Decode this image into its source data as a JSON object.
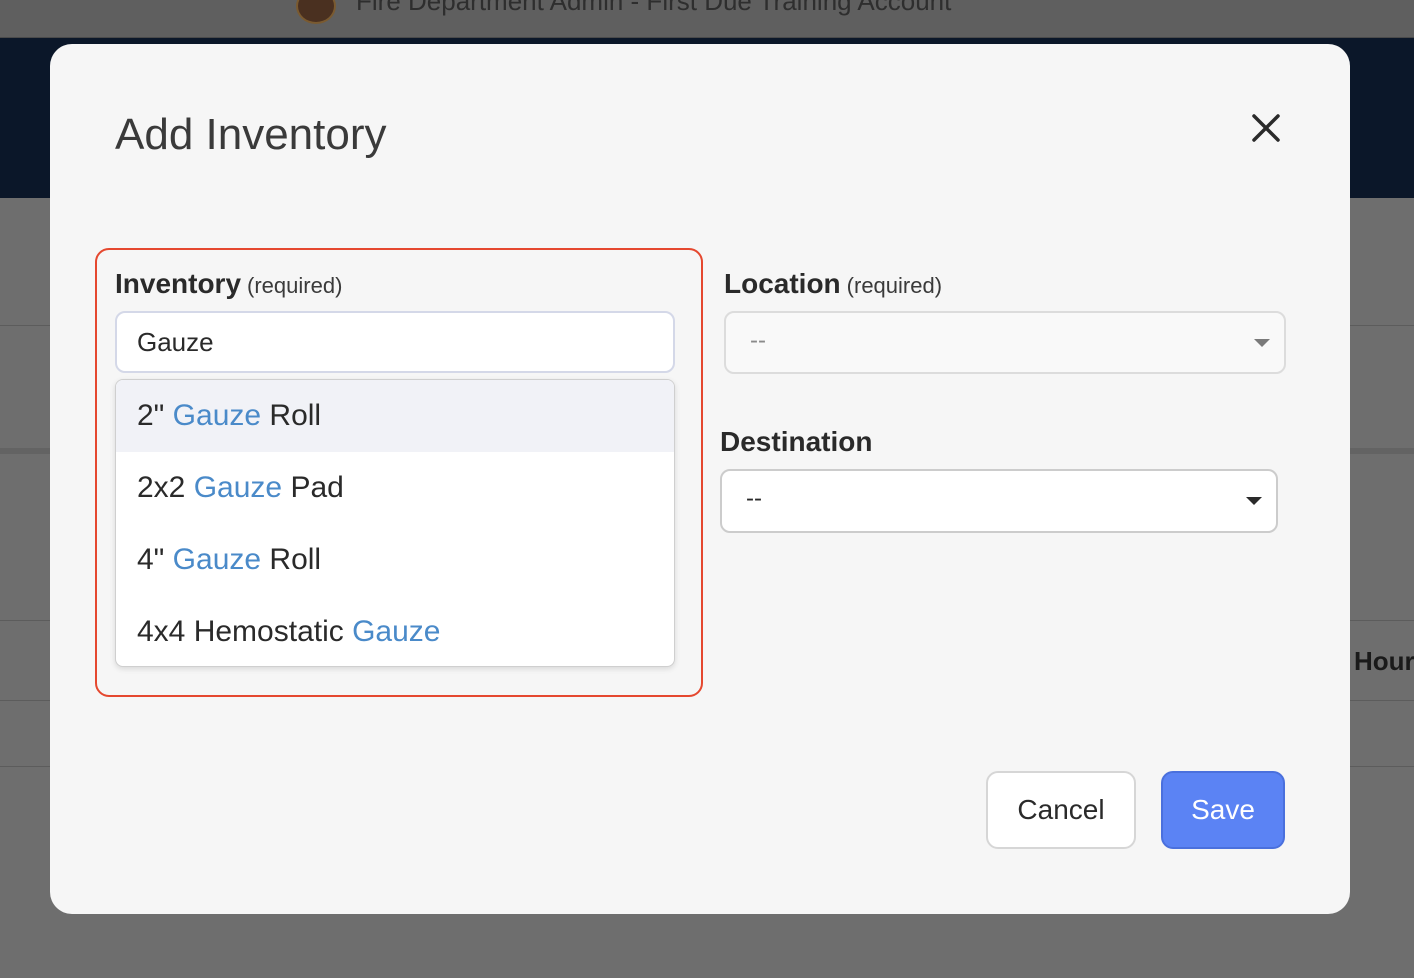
{
  "background": {
    "app_title": "Fire Department Admin - First Due Training Account",
    "partial_column_header": "Hour"
  },
  "modal": {
    "title": "Add Inventory",
    "close_icon": "close-icon"
  },
  "inventory_field": {
    "label": "Inventory",
    "required_note": "(required)",
    "value": "Gauze",
    "options": [
      {
        "prefix": "2\" ",
        "match": "Gauze",
        "suffix": " Roll"
      },
      {
        "prefix": "2x2 ",
        "match": "Gauze",
        "suffix": " Pad"
      },
      {
        "prefix": "4\" ",
        "match": "Gauze",
        "suffix": " Roll"
      },
      {
        "prefix": "4x4 Hemostatic ",
        "match": "Gauze",
        "suffix": ""
      }
    ],
    "highlighted_index": 0
  },
  "location_field": {
    "label": "Location",
    "required_note": "(required)",
    "value": "--"
  },
  "destination_field": {
    "label": "Destination",
    "value": "--"
  },
  "buttons": {
    "cancel": "Cancel",
    "save": "Save"
  },
  "colors": {
    "accent": "#5b83f4",
    "match_highlight": "#4a8ac9",
    "focus_frame": "#e5482f",
    "nav_band": "#0b1729"
  }
}
